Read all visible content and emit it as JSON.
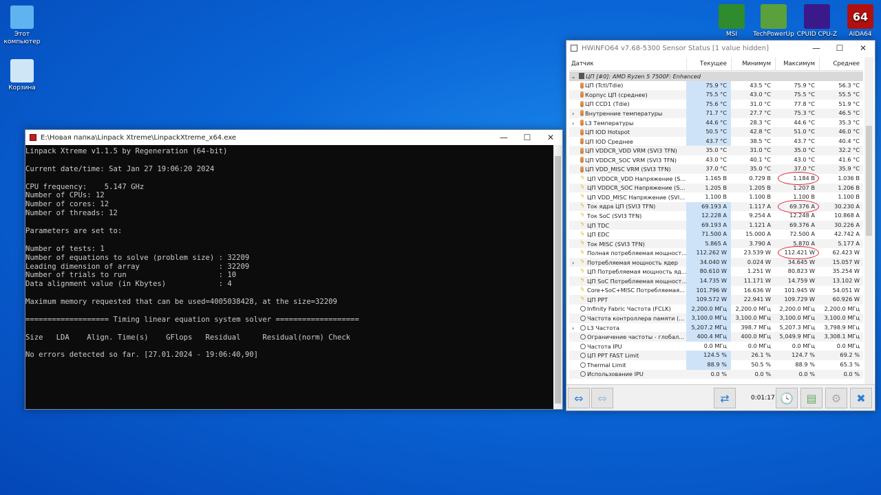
{
  "desktop": {
    "icons_left": [
      {
        "label": "Этот компьютер",
        "icon": "monitor-icon"
      },
      {
        "label": "Корзина",
        "icon": "recycle-bin-icon"
      }
    ],
    "icons_right": [
      {
        "label": "MSI",
        "icon": "msi-dragon-icon",
        "color": "#2e8b2e"
      },
      {
        "label": "TechPowerUp",
        "icon": "gpu-card-icon",
        "color": "#5aa03c"
      },
      {
        "label": "CPUID CPU-Z",
        "icon": "cpu-z-icon",
        "color": "#3a1a8a"
      },
      {
        "label": "AIDA64",
        "icon": "aida64-icon",
        "color": "#b01010"
      }
    ]
  },
  "console": {
    "title": "E:\\Новая папка\\Linpack Xtreme\\LinpackXtreme_x64.exe",
    "lines": [
      "Linpack Xtreme v1.1.5 by Regeneration (64-bit)",
      "",
      "Current date/time: Sat Jan 27 19:06:20 2024",
      "",
      "CPU frequency:    5.147 GHz",
      "Number of CPUs: 12",
      "Number of cores: 12",
      "Number of threads: 12",
      "",
      "Parameters are set to:",
      "",
      "Number of tests: 1",
      "Number of equations to solve (problem size) : 32209",
      "Leading dimension of array                  : 32209",
      "Number of trials to run                     : 10",
      "Data alignment value (in Kbytes)            : 4",
      "",
      "Maximum memory requested that can be used=4005038428, at the size=32209",
      "",
      "=================== Timing linear equation system solver ===================",
      "",
      "Size   LDA    Align. Time(s)    GFlops   Residual     Residual(norm) Check",
      "",
      "No errors detected so far. [27.01.2024 - 19:06:40,90]"
    ]
  },
  "hwinfo": {
    "title": "HWiNFO64 v7.68-5300 Sensor Status [1 value hidden]",
    "columns": [
      "Датчик",
      "Текущее",
      "Минимум",
      "Максимум",
      "Среднее"
    ],
    "group": "ЦП [#0]: AMD Ryzen 5 7500F: Enhanced",
    "rows": [
      {
        "label": "ЦП (Tctl/Tdie)",
        "icon": "therm",
        "cur": "75.9 °C",
        "min": "43.5 °C",
        "max": "75.9 °C",
        "avg": "56.3 °C",
        "hl": true
      },
      {
        "label": "Корпус ЦП (среднее)",
        "icon": "therm",
        "cur": "75.5 °C",
        "min": "43.0 °C",
        "max": "75.5 °C",
        "avg": "55.5 °C",
        "hl": true
      },
      {
        "label": "ЦП CCD1 (Tdie)",
        "icon": "therm",
        "cur": "75.6 °C",
        "min": "31.0 °C",
        "max": "77.8 °C",
        "avg": "51.9 °C",
        "hl": true
      },
      {
        "label": "Внутренние температуры",
        "icon": "therm",
        "cur": "71.7 °C",
        "min": "27.7 °C",
        "max": "75.3 °C",
        "avg": "46.5 °C",
        "hl": true,
        "expand": true
      },
      {
        "label": "L3 Температуры",
        "icon": "therm",
        "cur": "44.6 °C",
        "min": "28.3 °C",
        "max": "44.6 °C",
        "avg": "35.3 °C",
        "hl": true,
        "expand": true
      },
      {
        "label": "ЦП IOD Hotspot",
        "icon": "therm",
        "cur": "50.5 °C",
        "min": "42.8 °C",
        "max": "51.0 °C",
        "avg": "46.0 °C",
        "hl": true
      },
      {
        "label": "ЦП IOD Среднее",
        "icon": "therm",
        "cur": "43.7 °C",
        "min": "38.5 °C",
        "max": "43.7 °C",
        "avg": "40.4 °C",
        "hl": true
      },
      {
        "label": "ЦП VDDCR_VDD VRM (SVI3 TFN)",
        "icon": "therm",
        "cur": "35.0 °C",
        "min": "31.0 °C",
        "max": "35.0 °C",
        "avg": "32.2 °C"
      },
      {
        "label": "ЦП VDDCR_SOC VRM (SVI3 TFN)",
        "icon": "therm",
        "cur": "43.0 °C",
        "min": "40.1 °C",
        "max": "43.0 °C",
        "avg": "41.6 °C"
      },
      {
        "label": "ЦП VDD_MISC VRM (SVI3 TFN)",
        "icon": "therm",
        "cur": "37.0 °C",
        "min": "35.0 °C",
        "max": "37.0 °C",
        "avg": "35.9 °C"
      },
      {
        "label": "ЦП VDDCR_VDD Напряжение (S...",
        "icon": "bolt",
        "cur": "1.165 В",
        "min": "0.729 В",
        "max": "1.184 В",
        "avg": "1.036 В",
        "circled": true
      },
      {
        "label": "ЦП VDDCR_SOC Напряжение (S...",
        "icon": "bolt",
        "cur": "1.205 В",
        "min": "1.205 В",
        "max": "1.207 В",
        "avg": "1.206 В"
      },
      {
        "label": "ЦП VDD_MISC Напряжение (SVI...",
        "icon": "bolt",
        "cur": "1.100 В",
        "min": "1.100 В",
        "max": "1.100 В",
        "avg": "1.100 В"
      },
      {
        "label": "Ток ядра ЦП (SVI3 TFN)",
        "icon": "bolt",
        "cur": "69.193 A",
        "min": "1.117 A",
        "max": "69.376 A",
        "avg": "30.230 A",
        "hl": true,
        "circled": true
      },
      {
        "label": "Ток SoC (SVI3 TFN)",
        "icon": "bolt",
        "cur": "12.228 A",
        "min": "9.254 A",
        "max": "12.248 A",
        "avg": "10.868 A",
        "hl": true
      },
      {
        "label": "ЦП TDC",
        "icon": "bolt",
        "cur": "69.193 A",
        "min": "1.121 A",
        "max": "69.376 A",
        "avg": "30.226 A",
        "hl": true
      },
      {
        "label": "ЦП EDC",
        "icon": "bolt",
        "cur": "71.500 A",
        "min": "15.000 A",
        "max": "72.500 A",
        "avg": "42.742 A",
        "hl": true
      },
      {
        "label": "Ток MISC (SVI3 TFN)",
        "icon": "bolt",
        "cur": "5.865 A",
        "min": "3.790 A",
        "max": "5.870 A",
        "avg": "5.177 A",
        "hl": true
      },
      {
        "label": "Полная потребляемая мощност...",
        "icon": "bolt",
        "cur": "112.262 W",
        "min": "23.539 W",
        "max": "112.421 W",
        "avg": "62.423 W",
        "hl": true,
        "circled": true
      },
      {
        "label": "Потребляемая мощность ядер",
        "icon": "bolt",
        "cur": "34.040 W",
        "min": "0.024 W",
        "max": "34.645 W",
        "avg": "15.057 W",
        "hl": true,
        "expand": true
      },
      {
        "label": "ЦП Потребляемая мощность яд...",
        "icon": "bolt",
        "cur": "80.610 W",
        "min": "1.251 W",
        "max": "80.823 W",
        "avg": "35.254 W",
        "hl": true
      },
      {
        "label": "ЦП SoC Потребляемая мощност...",
        "icon": "bolt",
        "cur": "14.735 W",
        "min": "11.171 W",
        "max": "14.759 W",
        "avg": "13.102 W",
        "hl": true
      },
      {
        "label": "Core+SoC+MISC Потребляемая...",
        "icon": "bolt",
        "cur": "101.796 W",
        "min": "16.636 W",
        "max": "101.945 W",
        "avg": "54.051 W",
        "hl": true
      },
      {
        "label": "ЦП PPT",
        "icon": "bolt",
        "cur": "109.572 W",
        "min": "22.941 W",
        "max": "109.729 W",
        "avg": "60.926 W",
        "hl": true
      },
      {
        "label": "Infinity Fabric Частота (FCLK)",
        "icon": "clock",
        "cur": "2,200.0 МГц",
        "min": "2,200.0 МГц",
        "max": "2,200.0 МГц",
        "avg": "2,200.0 МГц",
        "hl": true
      },
      {
        "label": "Частота контроллера памяти (...",
        "icon": "clock",
        "cur": "3,100.0 МГц",
        "min": "3,100.0 МГц",
        "max": "3,100.0 МГц",
        "avg": "3,100.0 МГц",
        "hl": true
      },
      {
        "label": "L3 Частота",
        "icon": "clock",
        "cur": "5,207.2 МГц",
        "min": "398.7 МГц",
        "max": "5,207.3 МГц",
        "avg": "3,798.9 МГц",
        "hl": true,
        "expand": true
      },
      {
        "label": "Ограничение частоты - глобал...",
        "icon": "clock",
        "cur": "400.4 МГц",
        "min": "400.0 МГц",
        "max": "5,049.9 МГц",
        "avg": "3,308.1 МГц",
        "hl": true
      },
      {
        "label": "Частота IPU",
        "icon": "clock",
        "cur": "0.0 МГц",
        "min": "0.0 МГц",
        "max": "0.0 МГц",
        "avg": "0.0 МГц"
      },
      {
        "label": "ЦП PPT FAST Limit",
        "icon": "clock",
        "cur": "124.5 %",
        "min": "26.1 %",
        "max": "124.7 %",
        "avg": "69.2 %",
        "hl": true
      },
      {
        "label": "Thermal Limit",
        "icon": "clock",
        "cur": "88.9 %",
        "min": "50.5 %",
        "max": "88.9 %",
        "avg": "65.3 %",
        "hl": true
      },
      {
        "label": "Использование IPU",
        "icon": "clock",
        "cur": "0.0 %",
        "min": "0.0 %",
        "max": "0.0 %",
        "avg": "0.0 %"
      }
    ],
    "timer": "0:01:17"
  }
}
